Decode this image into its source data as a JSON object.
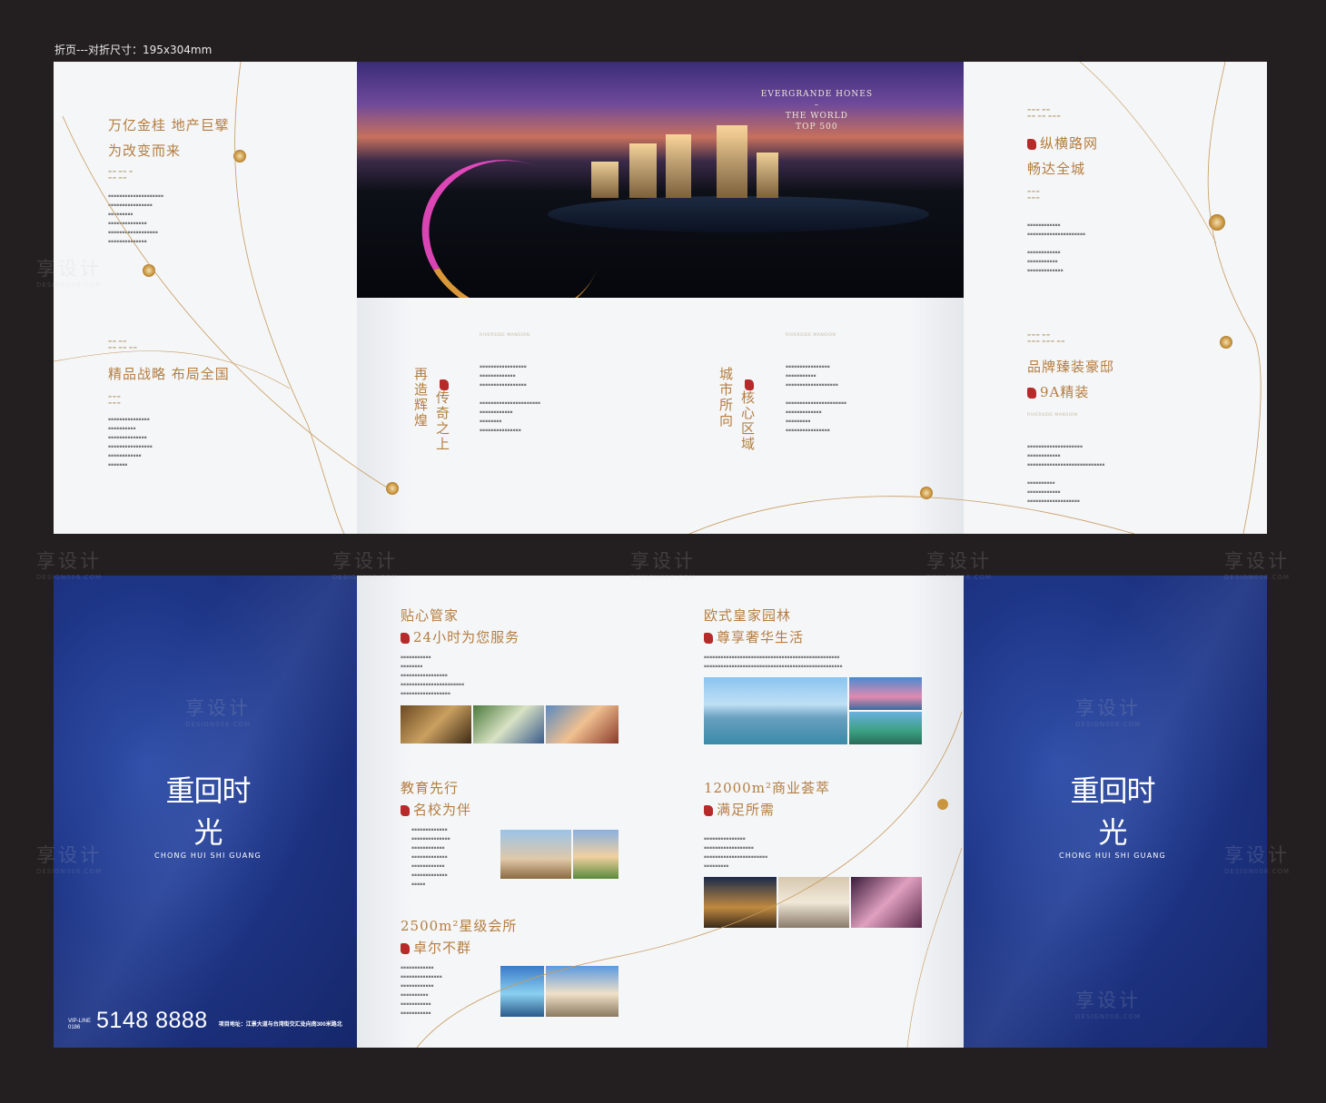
{
  "caption": "折页---对折尺寸：195x304mm",
  "top": {
    "p1": {
      "h1a": "万亿金桂 地产巨擘",
      "h1b": "为改变而来",
      "h2": "精品战略 布局全国"
    },
    "hero": {
      "l1": "EVERGRANDE HONES",
      "l2": "–",
      "l3": "THE WORLD",
      "l4": "TOP 500"
    },
    "p2": {
      "en": "RIVERSIDE MANSION",
      "v1": "传奇之上",
      "v2": "再造辉煌"
    },
    "p3": {
      "en": "RIVERSIDE MANSION",
      "v1": "核心区域",
      "v2": "城市所向"
    },
    "p4": {
      "en_top": "RIVERSIDE MANSION",
      "h1a": "纵横路网",
      "h1b": "畅达全城",
      "h2a": "品牌臻装豪邸",
      "h2b": "9A精装",
      "en2": "RIVERSIDE MANSION"
    }
  },
  "bottom": {
    "p2": {
      "s1a": "贴心管家",
      "s1b": "24小时为您服务",
      "s2a": "教育先行",
      "s2b": "名校为伴",
      "s3a": "2500m²星级会所",
      "s3b": "卓尔不群"
    },
    "p3": {
      "s1a": "欧式皇家园林",
      "s1b": "尊享奢华生活",
      "s2a": "12000m²商业荟萃",
      "s2b": "满足所需"
    },
    "logo": {
      "cn": "重回时光",
      "en": "CHONG HUI SHI GUANG"
    },
    "phone": {
      "tag1": "VIP-LINE",
      "tag2": "0186",
      "number": "5148 8888",
      "addr": "项目地址：江景大道与台湾街交汇处向南300米路北"
    }
  },
  "watermark": {
    "cn": "享设计",
    "en": "DESIGN006.COM"
  },
  "colors": {
    "gold": "#b57d3f",
    "navy": "#1e3586",
    "paper": "#f4f6f8",
    "seal": "#b72a2a"
  }
}
